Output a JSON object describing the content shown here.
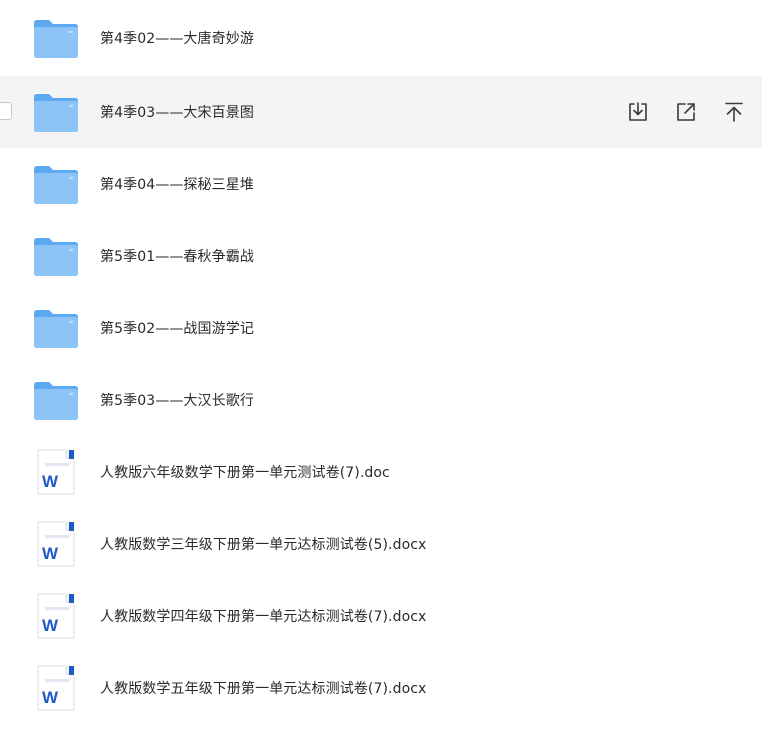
{
  "files": [
    {
      "name": "第4季02——大唐奇妙游",
      "type": "folder",
      "icon": "folder-icon"
    },
    {
      "name": "第4季03——大宋百景图",
      "type": "folder",
      "icon": "folder-icon"
    },
    {
      "name": "第4季04——探秘三星堆",
      "type": "folder",
      "icon": "folder-icon"
    },
    {
      "name": "第5季01——春秋争霸战",
      "type": "folder",
      "icon": "folder-icon"
    },
    {
      "name": "第5季02——战国游学记",
      "type": "folder",
      "icon": "folder-icon"
    },
    {
      "name": "第5季03——大汉长歌行",
      "type": "folder",
      "icon": "folder-icon"
    },
    {
      "name": "人教版六年级数学下册第一单元测试卷(7).doc",
      "type": "word",
      "icon": "word-doc-icon"
    },
    {
      "name": "人教版数学三年级下册第一单元达标测试卷(5).docx",
      "type": "word",
      "icon": "word-doc-icon"
    },
    {
      "name": "人教版数学四年级下册第一单元达标测试卷(7).docx",
      "type": "word",
      "icon": "word-doc-icon"
    },
    {
      "name": "人教版数学五年级下册第一单元达标测试卷(7).docx",
      "type": "word",
      "icon": "word-doc-icon"
    }
  ],
  "hover_actions": [
    {
      "name": "download",
      "icon": "download-icon"
    },
    {
      "name": "share",
      "icon": "share-icon"
    },
    {
      "name": "move-to-top",
      "icon": "pin-top-icon"
    }
  ],
  "colors": {
    "folder_back": "#5ea8ef",
    "folder_front": "#8cc4f8",
    "word_blue": "#1f5bc6",
    "hover_bg": "#f4f4f5",
    "text": "#2a2a2e",
    "action_icon": "#3a3a3a"
  }
}
